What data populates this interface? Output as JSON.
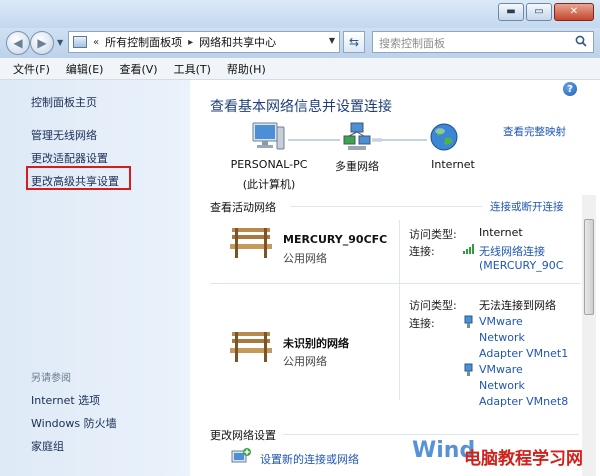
{
  "window": {
    "minimize_glyph": "▬",
    "maximize_glyph": "▭",
    "close_glyph": "✕"
  },
  "address": {
    "chevron": "«",
    "crumb1": "所有控制面板项",
    "separator": "▸",
    "crumb2": "网络和共享中心",
    "search_placeholder": "搜索控制面板"
  },
  "menu": [
    "文件(F)",
    "编辑(E)",
    "查看(V)",
    "工具(T)",
    "帮助(H)"
  ],
  "sidebar": {
    "home": "控制面板主页",
    "items": [
      "管理无线网络",
      "更改适配器设置",
      "更改高级共享设置"
    ],
    "see_also_title": "另请参阅",
    "see_also": [
      "Internet 选项",
      "Windows 防火墙",
      "家庭组"
    ]
  },
  "main": {
    "heading": "查看基本网络信息并设置连接",
    "full_map_link": "查看完整映射",
    "nodes": {
      "pc_name": "PERSONAL-PC",
      "pc_sub": "(此计算机)",
      "multi": "多重网络",
      "internet": "Internet"
    },
    "active_title": "查看活动网络",
    "connect_link": "连接或断开连接",
    "net1": {
      "name": "MERCURY_90CFC",
      "type": "公用网络",
      "access_key": "访问类型:",
      "access_val": "Internet",
      "conn_key": "连接:",
      "conn_val1": "无线网络连接",
      "conn_val2": "(MERCURY_90C"
    },
    "net2": {
      "name": "未识别的网络",
      "type": "公用网络",
      "access_key": "访问类型:",
      "access_val": "无法连接到网络",
      "conn_key": "连接:",
      "adapter1_a": "VMware",
      "adapter1_b": "Network",
      "adapter1_c": "Adapter VMnet1",
      "adapter2_a": "VMware",
      "adapter2_b": "Network",
      "adapter2_c": "Adapter VMnet8"
    },
    "change_title": "更改网络设置",
    "new_connection": "设置新的连接或网络"
  },
  "watermark": {
    "blue": "Wind",
    "red": "电脑教程学习网"
  },
  "colors": {
    "link": "#1f56b5",
    "heading": "#1f3f7a",
    "highlight_box": "#d41e1e"
  }
}
